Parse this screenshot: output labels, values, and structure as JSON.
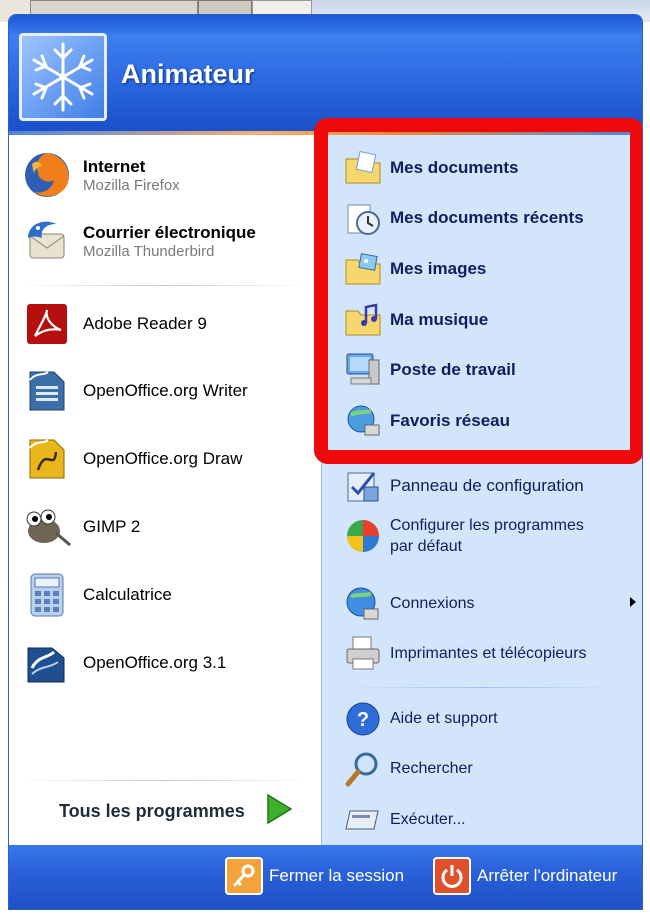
{
  "user": {
    "name": "Animateur"
  },
  "pinned": [
    {
      "title": "Internet",
      "subtitle": "Mozilla Firefox"
    },
    {
      "title": "Courrier électronique",
      "subtitle": "Mozilla Thunderbird"
    }
  ],
  "recent": [
    {
      "label": "Adobe Reader 9"
    },
    {
      "label": "OpenOffice.org Writer"
    },
    {
      "label": "OpenOffice.org Draw"
    },
    {
      "label": "GIMP 2"
    },
    {
      "label": "Calculatrice"
    },
    {
      "label": "OpenOffice.org 3.1"
    }
  ],
  "all_programs": {
    "label": "Tous les programmes"
  },
  "places": [
    {
      "label": "Mes documents",
      "icon": "folder-documents-icon"
    },
    {
      "label": "Mes documents récents",
      "icon": "recent-documents-icon"
    },
    {
      "label": "Mes images",
      "icon": "folder-images-icon"
    },
    {
      "label": "Ma musique",
      "icon": "folder-music-icon"
    },
    {
      "label": "Poste de travail",
      "icon": "computer-icon"
    },
    {
      "label": "Favoris réseau",
      "icon": "network-icon"
    }
  ],
  "system": {
    "control_panel": "Panneau de configuration",
    "default_programs_1": "Configurer les programmes",
    "default_programs_2": "par défaut",
    "connections": "Connexions",
    "printers": "Imprimantes et télécopieurs",
    "help": "Aide et support",
    "search": "Rechercher",
    "run": "Exécuter..."
  },
  "footer": {
    "logoff": "Fermer la session",
    "shutdown": "Arrêter l'ordinateur"
  },
  "colors": {
    "highlight_box": "#ee0a0a",
    "header_blue": "#2a66df",
    "places_bg": "#d3e5fb"
  }
}
